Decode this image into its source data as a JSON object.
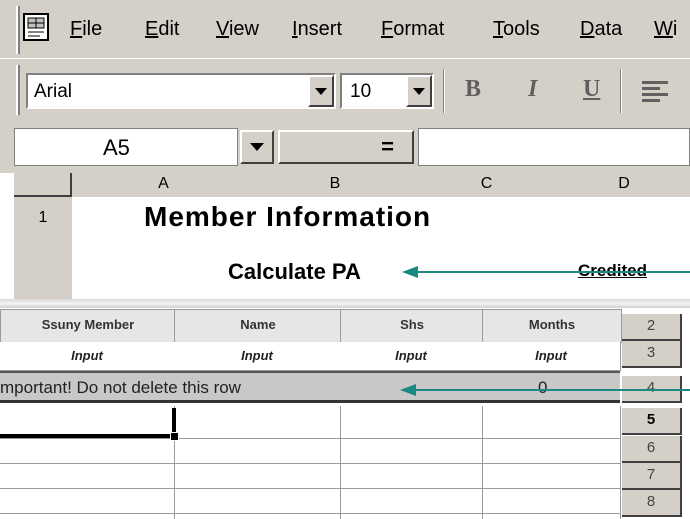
{
  "menu": {
    "items": [
      "File",
      "Edit",
      "View",
      "Insert",
      "Format",
      "Tools",
      "Data",
      "Wi"
    ]
  },
  "format_toolbar": {
    "font_name": "Arial",
    "font_size": "10",
    "bold_glyph": "B",
    "italic_glyph": "I",
    "underline_glyph": "U"
  },
  "formula_bar": {
    "name_box": "A5",
    "equals": "="
  },
  "columns": [
    "A",
    "B",
    "C",
    "D"
  ],
  "rows": {
    "r1_number": "1",
    "title": "Member Information",
    "calculate": "Calculate PA",
    "credited": "Credited"
  },
  "table": {
    "headers": [
      "Ssuny Member",
      "Name",
      "Shs",
      "Months"
    ],
    "input_label": "Input",
    "input_labels": [
      "Input",
      "Input",
      "Input",
      "Input"
    ],
    "important_note": "mportant! Do not delete this row",
    "zero_value": "0"
  },
  "row_numbers": [
    "2",
    "3",
    "4",
    "5",
    "6",
    "7",
    "8"
  ],
  "colors": {
    "chrome": "#d4d0c8",
    "arrow": "#1a8a80"
  },
  "icons": {
    "app": "excel-doc-icon",
    "dropdown": "chevron-down-icon",
    "align": "align-left-icon"
  }
}
